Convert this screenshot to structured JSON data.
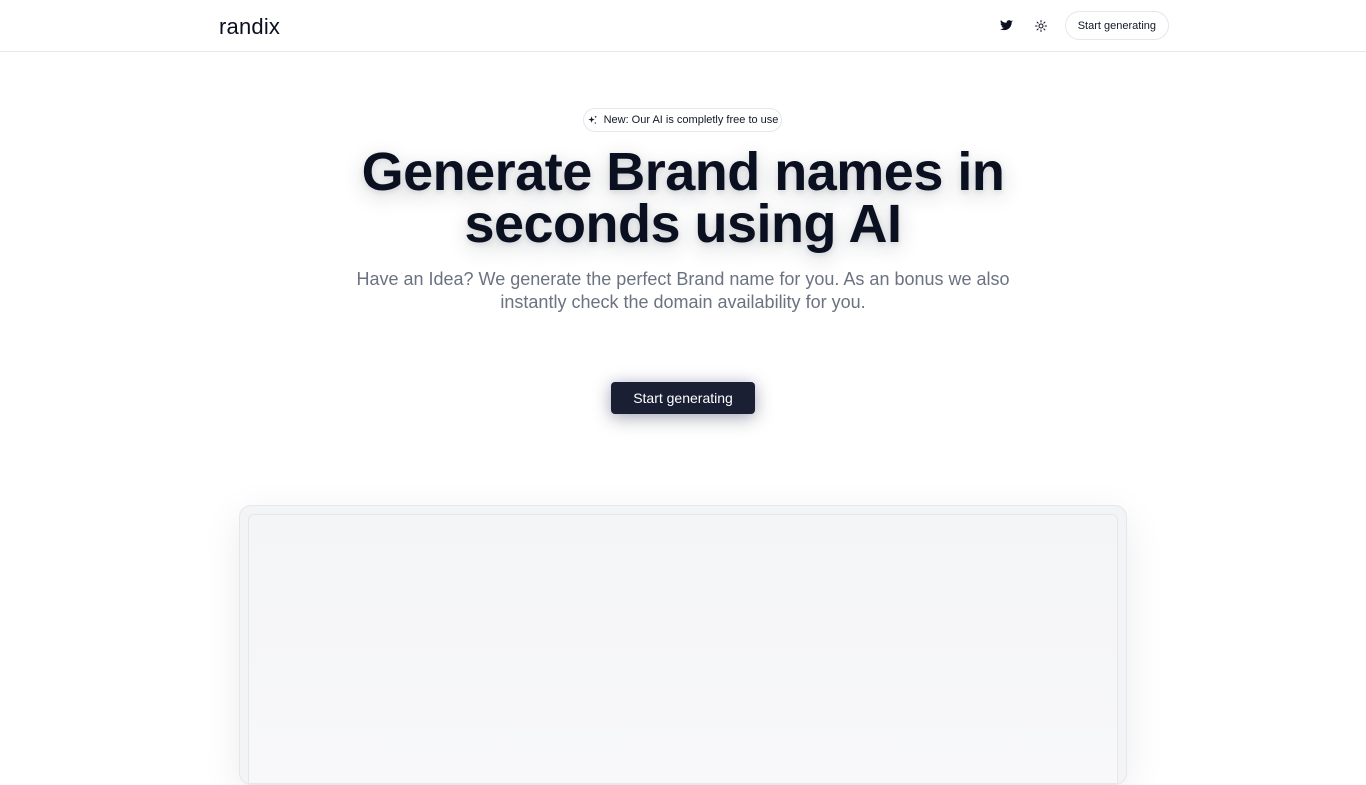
{
  "header": {
    "logo": "randix",
    "cta_label": "Start generating",
    "icons": [
      "twitter-icon",
      "sun-icon"
    ]
  },
  "hero": {
    "badge": {
      "icon": "sparkles-icon",
      "text": "New: Our AI is completly free to use"
    },
    "title_line1": "Generate Brand names in",
    "title_line2": "seconds using AI",
    "subtitle_line1": "Have an Idea? We generate the perfect Brand name for you. As an bonus we also",
    "subtitle_line2": "instantly check the domain availability for you.",
    "cta_label": "Start generating"
  },
  "colors": {
    "primary": "#1a1f33",
    "text": "#0b1020",
    "muted": "#6b7280",
    "border": "#e5e7eb"
  }
}
